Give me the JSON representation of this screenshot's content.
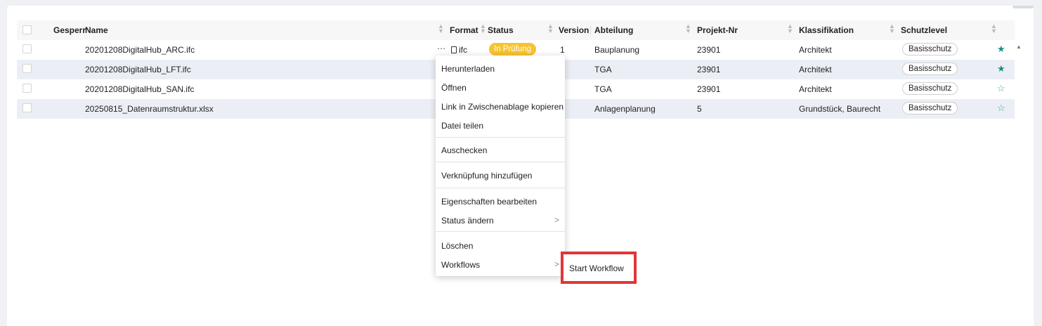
{
  "table": {
    "columns": [
      "Gesperr",
      "Name",
      "Format",
      "Status",
      "Version",
      "Abteilung",
      "Projekt-Nr",
      "Klassifikation",
      "Schutzlevel"
    ],
    "rows": [
      {
        "name": "20201208DigitalHub_ARC.ifc",
        "format": "ifc",
        "status": "In Prüfung",
        "version": "1",
        "abteilung": "Bauplanung",
        "projekt": "23901",
        "klass": "Architekt",
        "schutz": "Basisschutz",
        "starred": true
      },
      {
        "name": "20201208DigitalHub_LFT.ifc",
        "abteilung": "TGA",
        "projekt": "23901",
        "klass": "Architekt",
        "schutz": "Basisschutz",
        "starred": true
      },
      {
        "name": "20201208DigitalHub_SAN.ifc",
        "abteilung": "TGA",
        "projekt": "23901",
        "klass": "Architekt",
        "schutz": "Basisschutz",
        "starred": false
      },
      {
        "name": "20250815_Datenraumstruktur.xlsx",
        "abteilung": "Anlagenplanung",
        "projekt": "5",
        "klass": "Grundstück, Baurecht",
        "schutz": "Basisschutz",
        "starred": false
      }
    ],
    "more_icon": "⋯"
  },
  "context_menu": {
    "items": [
      {
        "label": "Herunterladen"
      },
      {
        "label": "Öffnen"
      },
      {
        "label": "Link in Zwischenablage kopieren"
      },
      {
        "label": "Datei teilen"
      },
      {
        "label": "Auschecken"
      },
      {
        "label": "Verknüpfung hinzufügen"
      },
      {
        "label": "Eigenschaften bearbeiten"
      },
      {
        "label": "Status ändern"
      },
      {
        "label": "Löschen"
      },
      {
        "label": "Workflows"
      }
    ],
    "submenu": {
      "label": "Start Workflow"
    }
  },
  "colors": {
    "status_badge": "#f7c32e",
    "star": "#1a8f86",
    "highlight": "#e23636",
    "row_alt": "#ebeff5"
  }
}
